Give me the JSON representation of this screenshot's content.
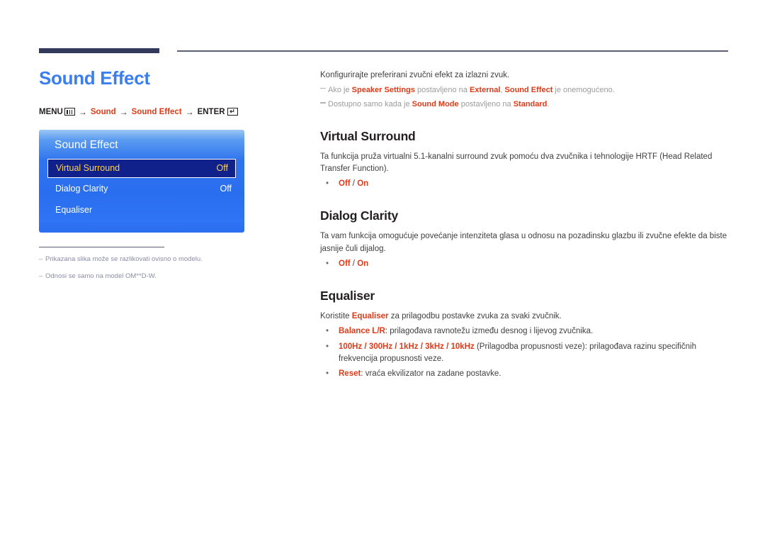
{
  "page": {
    "title": "Sound Effect"
  },
  "breadcrumb": {
    "menu_label": "MENU",
    "menu_icon": "menu-bars-icon",
    "arrow": "→",
    "step1": "Sound",
    "step2": "Sound Effect",
    "enter_label": "ENTER",
    "enter_icon": "enter-return-icon"
  },
  "osd": {
    "title": "Sound Effect",
    "rows": [
      {
        "label": "Virtual Surround",
        "value": "Off",
        "selected": true
      },
      {
        "label": "Dialog Clarity",
        "value": "Off",
        "selected": false
      },
      {
        "label": "Equaliser",
        "value": "",
        "selected": false
      }
    ]
  },
  "left_notes": {
    "dash": "–",
    "items": [
      "Prikazana slika može se razlikovati ovisno o modelu.",
      "Odnosi se samo na model OM**D-W."
    ]
  },
  "intro": {
    "line": "Konfigurirajte preferirani zvučni efekt za izlazni zvuk.",
    "note1": {
      "p1": "Ako je ",
      "b1": "Speaker Settings",
      "p2": " postavljeno na ",
      "b2": "External",
      "p3": ", ",
      "b3": "Sound Effect",
      "p4": " je onemogućeno."
    },
    "note2": {
      "p1": "Dostupno samo kada je ",
      "b1": "Sound Mode",
      "p2": " postavljeno na ",
      "b2": "Standard",
      "p3": "."
    }
  },
  "sections": {
    "virtual_surround": {
      "title": "Virtual Surround",
      "body": "Ta funkcija pruža virtualni 5.1-kanalni surround zvuk pomoću dva zvučnika i tehnologije HRTF (Head Related Transfer Function).",
      "option_off": "Off",
      "option_sep": " / ",
      "option_on": "On"
    },
    "dialog_clarity": {
      "title": "Dialog Clarity",
      "body": "Ta vam funkcija omogućuje povećanje intenziteta glasa u odnosu na pozadinsku glazbu ili zvučne efekte da biste jasnije čuli dijalog.",
      "option_off": "Off",
      "option_sep": " / ",
      "option_on": "On"
    },
    "equaliser": {
      "title": "Equaliser",
      "body_p1": "Koristite ",
      "body_b1": "Equaliser",
      "body_p2": " za prilagodbu postavke zvuka za svaki zvučnik.",
      "bullet_dot": "•",
      "item1": {
        "term": "Balance L/R",
        "rest": ": prilagođava ravnotežu između desnog i lijevog zvučnika."
      },
      "item2": {
        "term": "100Hz / 300Hz / 1kHz / 3kHz / 10kHz",
        "rest": " (Prilagodba propusnosti veze): prilagođava razinu specifičnih frekvencija propusnosti veze."
      },
      "item3": {
        "term": "Reset",
        "rest": ": vraća ekvilizator na zadane postavke."
      }
    }
  },
  "colors": {
    "accent_blue": "#3b7ef0",
    "accent_red": "#e03a18",
    "rule_navy": "#333a5c",
    "osd_highlight": "#11218c",
    "osd_highlight_text": "#ffd24d"
  }
}
